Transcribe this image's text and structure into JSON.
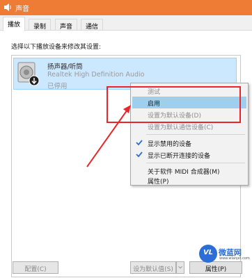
{
  "window": {
    "title": "声音",
    "title_icon": "speaker-icon"
  },
  "tabs": [
    {
      "label": "播放",
      "active": true
    },
    {
      "label": "录制",
      "active": false
    },
    {
      "label": "声音",
      "active": false
    },
    {
      "label": "通信",
      "active": false
    }
  ],
  "instruction": "选择以下播放设备来修改其设置:",
  "device": {
    "name": "扬声器/听筒",
    "driver": "Realtek High Definition Audio",
    "status": "已停用"
  },
  "context_menu": {
    "items": [
      {
        "label": "测试",
        "disabled": true,
        "checked": false,
        "highlighted": false
      },
      {
        "label": "启用",
        "disabled": false,
        "checked": false,
        "highlighted": true
      },
      {
        "label": "设置为默认设备(D)",
        "disabled": true,
        "checked": false,
        "highlighted": false
      },
      {
        "label": "设置为默认通信设备(C)",
        "disabled": true,
        "checked": false,
        "highlighted": false
      },
      {
        "label": "显示禁用的设备",
        "disabled": false,
        "checked": true,
        "highlighted": false
      },
      {
        "label": "显示已断开连接的设备",
        "disabled": false,
        "checked": true,
        "highlighted": false
      },
      {
        "label": "关于软件 MIDI 合成器(M)",
        "disabled": false,
        "checked": false,
        "highlighted": false
      },
      {
        "label": "属性(P)",
        "disabled": false,
        "checked": false,
        "highlighted": false
      }
    ]
  },
  "buttons": {
    "configure": "配置(C)",
    "set_default": "设为默认值(S)",
    "properties": "属性(P)"
  },
  "watermark": {
    "brand": "微蓝网",
    "url": "www.wlanjet.com"
  },
  "colors": {
    "titlebar": "#ef7c35",
    "selection": "#cce8ff",
    "highlight": "#9fcfef",
    "annotation": "#e8262a",
    "check": "#2a6dd0"
  }
}
